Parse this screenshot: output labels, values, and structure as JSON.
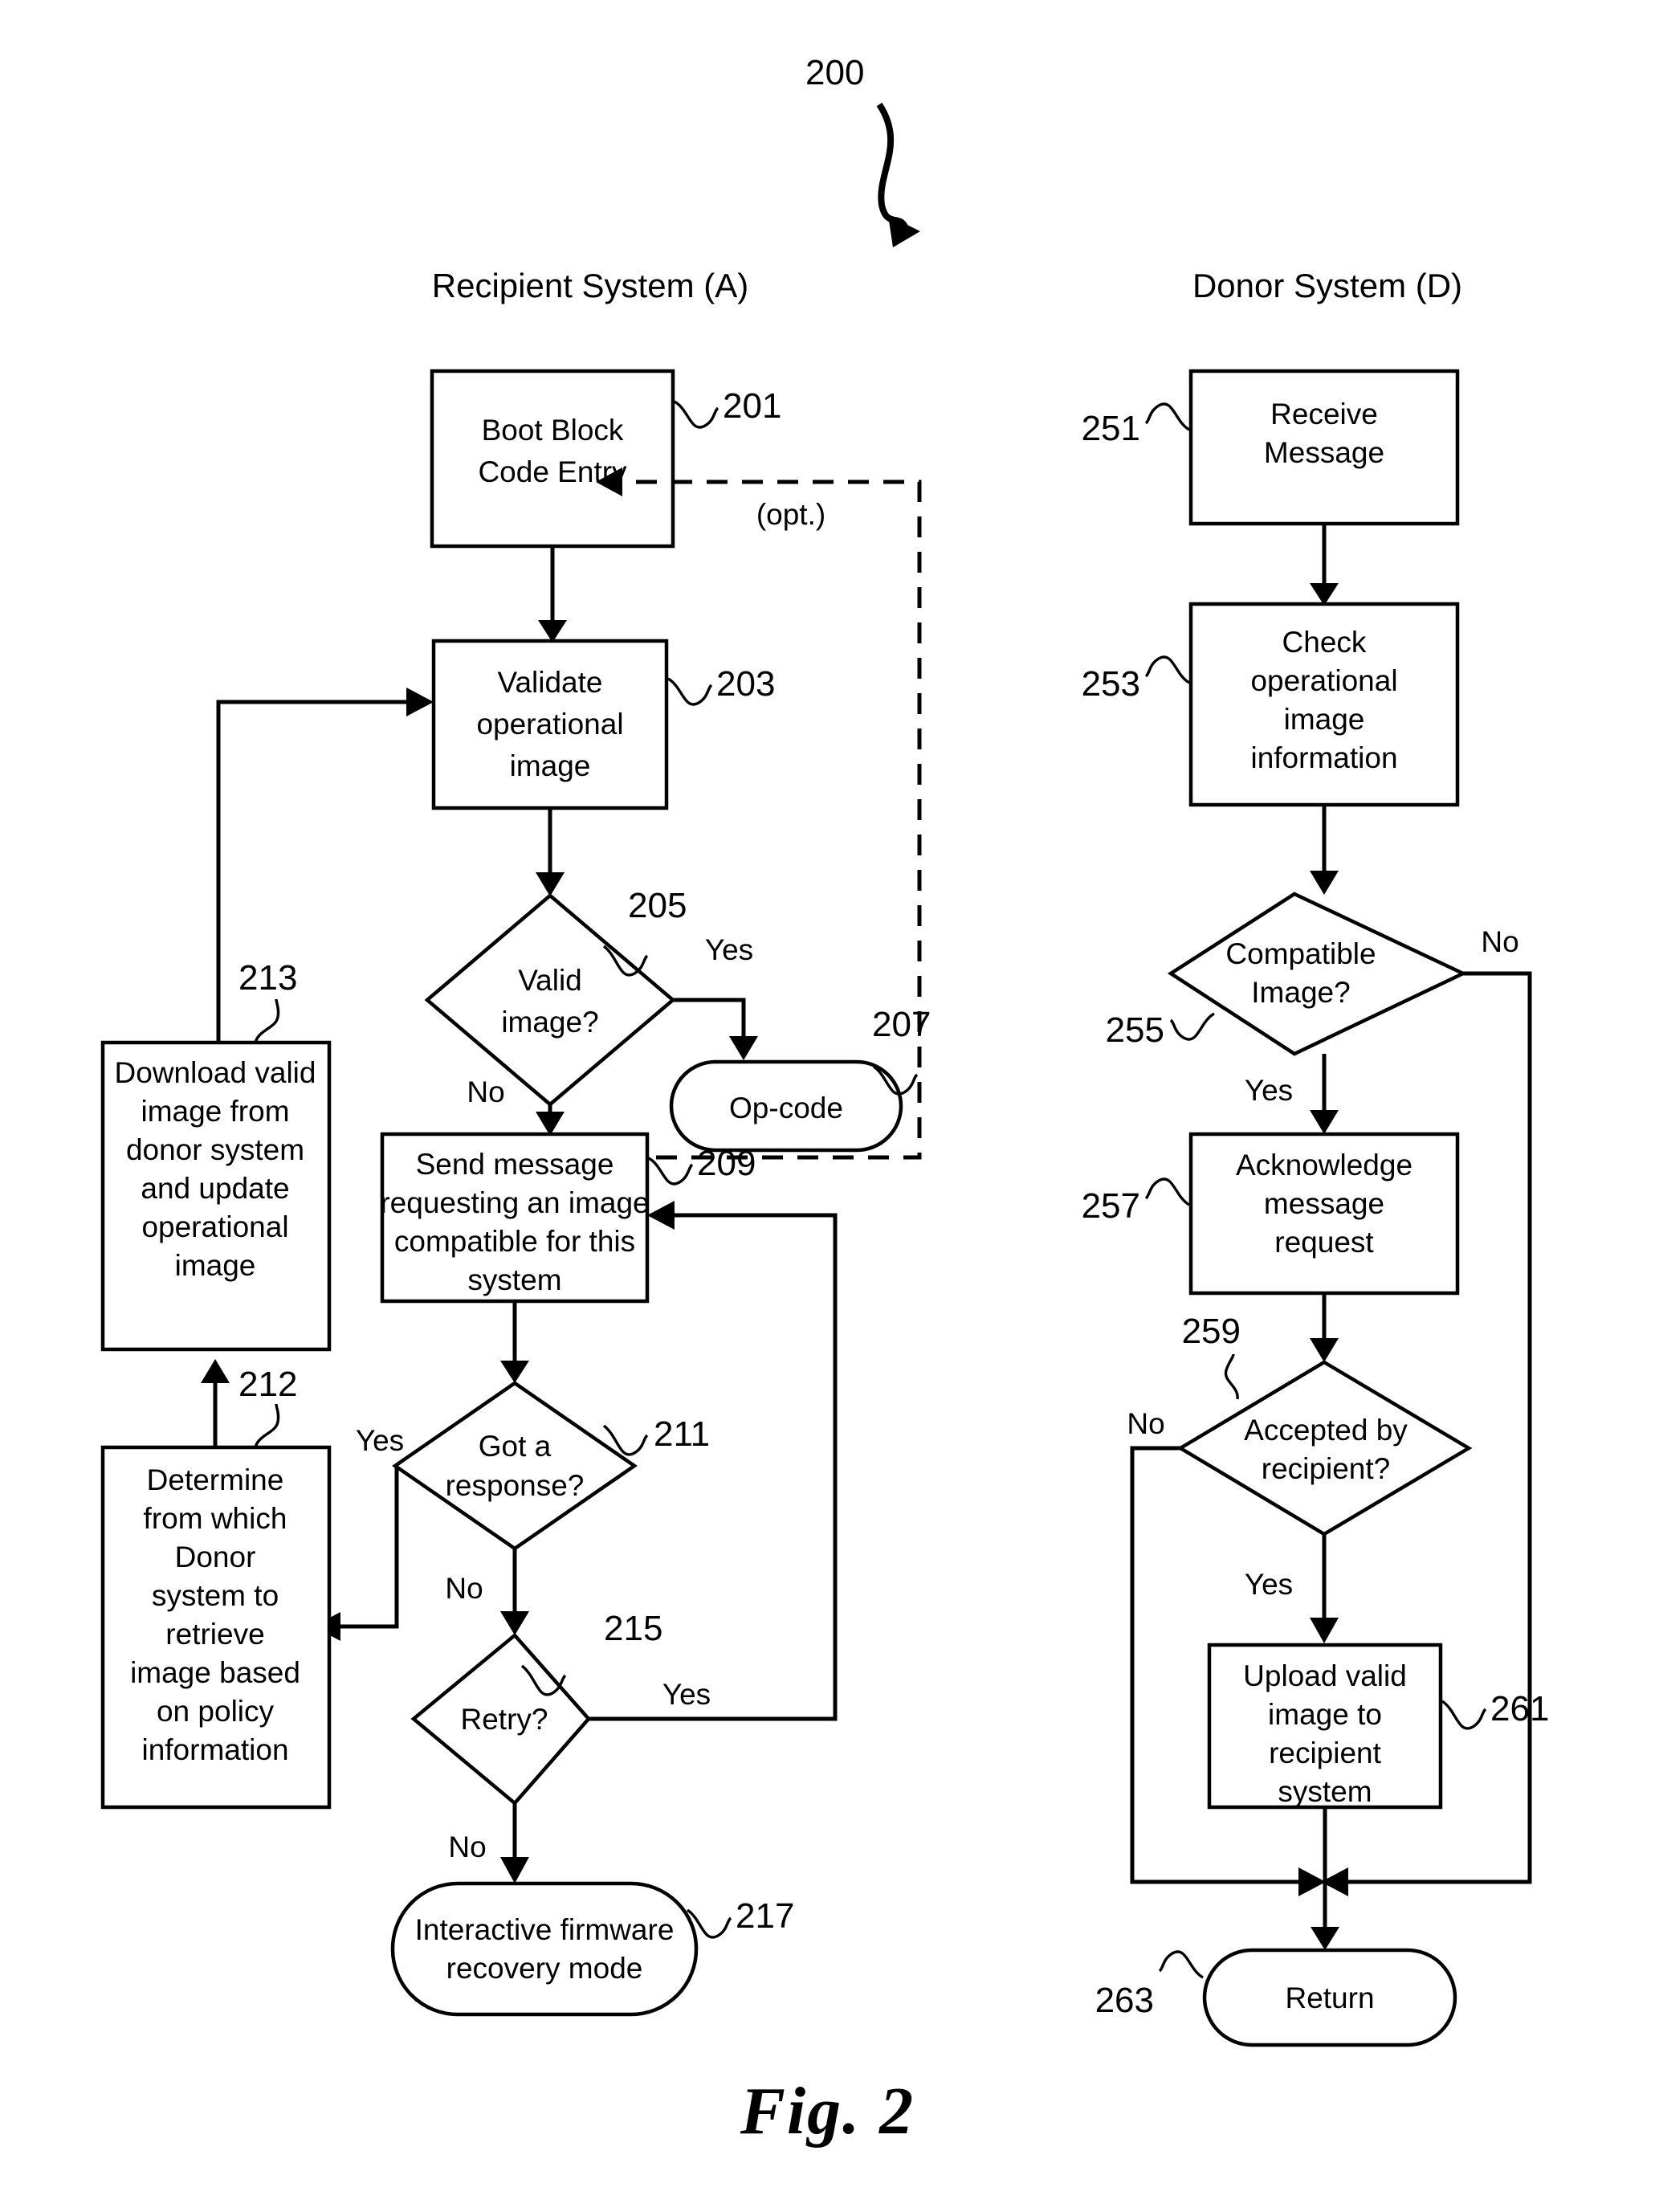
{
  "figure": {
    "number_label": "200",
    "caption": "Fig. 2",
    "columns": [
      {
        "id": "recipient",
        "title": "Recipient System (A)"
      },
      {
        "id": "donor",
        "title": "Donor System (D)"
      }
    ]
  },
  "recipient_flow": {
    "nodes": [
      {
        "ref": "201",
        "shape": "process",
        "lines": [
          "Boot Block",
          "Code Entry"
        ]
      },
      {
        "ref": "203",
        "shape": "process",
        "lines": [
          "Validate",
          "operational",
          "image"
        ]
      },
      {
        "ref": "205",
        "shape": "decision",
        "lines": [
          "Valid",
          "image?"
        ]
      },
      {
        "ref": "207",
        "shape": "terminator",
        "lines": [
          "Op-code"
        ]
      },
      {
        "ref": "209",
        "shape": "process",
        "lines": [
          "Send message",
          "requesting an image",
          "compatible for this",
          "system"
        ]
      },
      {
        "ref": "211",
        "shape": "decision",
        "lines": [
          "Got a",
          "response?"
        ]
      },
      {
        "ref": "212",
        "shape": "process",
        "lines": [
          "Determine",
          "from which",
          "Donor",
          "system to",
          "retrieve",
          "image based",
          "on policy",
          "information"
        ]
      },
      {
        "ref": "213",
        "shape": "process",
        "lines": [
          "Download valid",
          "image from",
          "donor system",
          "and update",
          "operational",
          "image"
        ]
      },
      {
        "ref": "215",
        "shape": "decision",
        "lines": [
          "Retry?"
        ]
      },
      {
        "ref": "217",
        "shape": "terminator",
        "lines": [
          "Interactive firmware",
          "recovery mode"
        ]
      }
    ],
    "edge_labels": {
      "valid_yes": "Yes",
      "valid_no": "No",
      "opt": "(opt.)",
      "response_yes": "Yes",
      "response_no": "No",
      "retry_yes": "Yes",
      "retry_no": "No"
    }
  },
  "donor_flow": {
    "nodes": [
      {
        "ref": "251",
        "shape": "process",
        "lines": [
          "Receive",
          "Message"
        ]
      },
      {
        "ref": "253",
        "shape": "process",
        "lines": [
          "Check",
          "operational",
          "image",
          "information"
        ]
      },
      {
        "ref": "255",
        "shape": "decision",
        "lines": [
          "Compatible",
          "Image?"
        ]
      },
      {
        "ref": "257",
        "shape": "process",
        "lines": [
          "Acknowledge",
          "message",
          "request"
        ]
      },
      {
        "ref": "259",
        "shape": "decision",
        "lines": [
          "Accepted by",
          "recipient?"
        ]
      },
      {
        "ref": "261",
        "shape": "process",
        "lines": [
          "Upload valid",
          "image to",
          "recipient",
          "system"
        ]
      },
      {
        "ref": "263",
        "shape": "terminator",
        "lines": [
          "Return"
        ]
      }
    ],
    "edge_labels": {
      "compatible_yes": "Yes",
      "compatible_no": "No",
      "accepted_yes": "Yes",
      "accepted_no": "No"
    }
  }
}
